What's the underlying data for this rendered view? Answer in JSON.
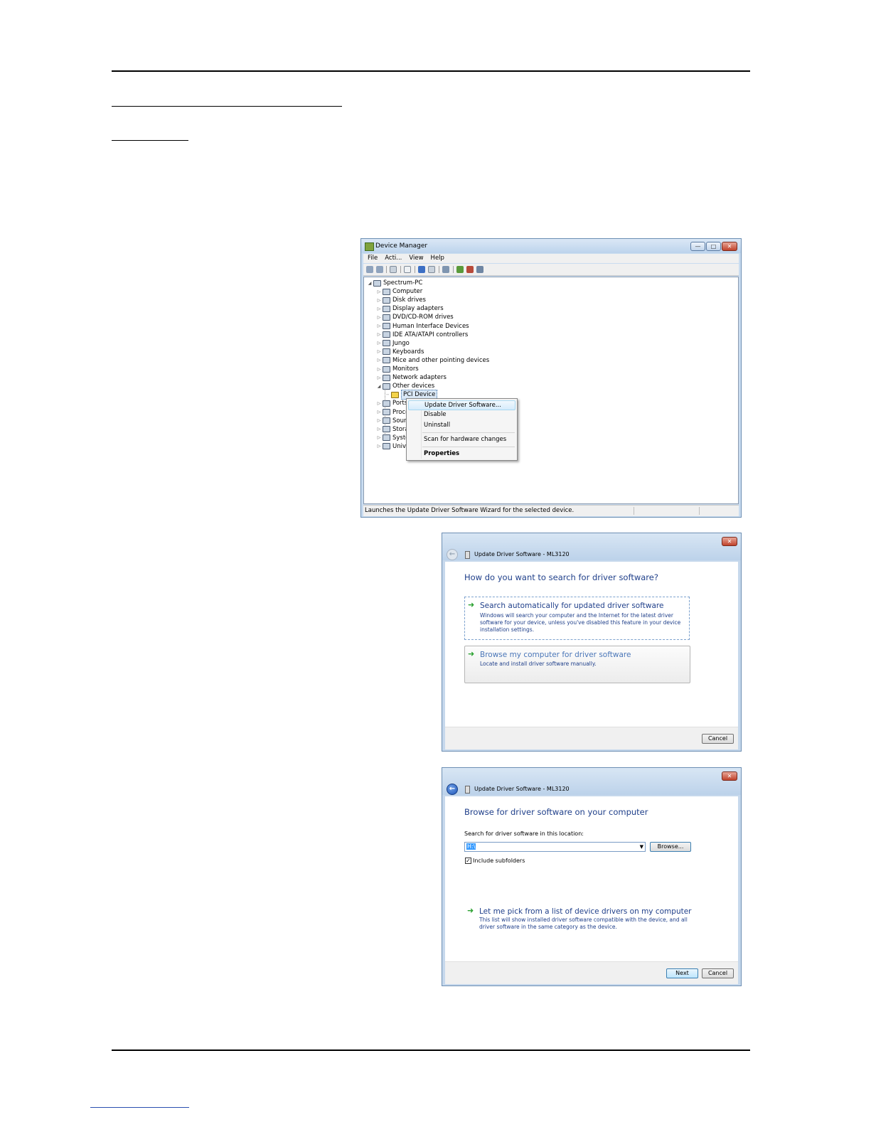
{
  "device_manager": {
    "title": "Device Manager",
    "menu": [
      "File",
      "Acti...",
      "View",
      "Help"
    ],
    "tree": [
      {
        "label": "Spectrum-PC",
        "icon": "computer-network-icon",
        "level": 0,
        "expander": "open"
      },
      {
        "label": "Computer",
        "icon": "computer-icon",
        "level": 1,
        "expander": "closed"
      },
      {
        "label": "Disk drives",
        "icon": "disk-drive-icon",
        "level": 1,
        "expander": "closed"
      },
      {
        "label": "Display adapters",
        "icon": "display-adapter-icon",
        "level": 1,
        "expander": "closed"
      },
      {
        "label": "DVD/CD-ROM drives",
        "icon": "dvd-drive-icon",
        "level": 1,
        "expander": "closed"
      },
      {
        "label": "Human Interface Devices",
        "icon": "hid-icon",
        "level": 1,
        "expander": "closed"
      },
      {
        "label": "IDE ATA/ATAPI controllers",
        "icon": "ide-controller-icon",
        "level": 1,
        "expander": "closed"
      },
      {
        "label": "Jungo",
        "icon": "jungo-icon",
        "level": 1,
        "expander": "closed"
      },
      {
        "label": "Keyboards",
        "icon": "keyboard-icon",
        "level": 1,
        "expander": "closed"
      },
      {
        "label": "Mice and other pointing devices",
        "icon": "mouse-icon",
        "level": 1,
        "expander": "closed"
      },
      {
        "label": "Monitors",
        "icon": "monitor-icon",
        "level": 1,
        "expander": "closed"
      },
      {
        "label": "Network adapters",
        "icon": "network-adapter-icon",
        "level": 1,
        "expander": "closed"
      },
      {
        "label": "Other devices",
        "icon": "other-devices-icon",
        "level": 1,
        "expander": "open"
      },
      {
        "label": "PCI Device",
        "icon": "warning-device-icon",
        "level": 2,
        "expander": "none",
        "selected": true
      },
      {
        "label": "Ports",
        "icon": "port-icon",
        "level": 1,
        "expander": "closed"
      },
      {
        "label": "Proce",
        "icon": "processor-icon",
        "level": 1,
        "expander": "closed"
      },
      {
        "label": "Soun",
        "icon": "sound-icon",
        "level": 1,
        "expander": "closed"
      },
      {
        "label": "Stora",
        "icon": "storage-icon",
        "level": 1,
        "expander": "closed"
      },
      {
        "label": "Syste",
        "icon": "system-icon",
        "level": 1,
        "expander": "closed"
      },
      {
        "label": "Unive",
        "icon": "usb-icon",
        "level": 1,
        "expander": "closed"
      }
    ],
    "context_menu": [
      {
        "label": "Update Driver Software...",
        "highlighted": true
      },
      {
        "label": "Disable"
      },
      {
        "label": "Uninstall"
      },
      {
        "label": "Scan for hardware changes"
      },
      {
        "label": "Properties",
        "bold": true
      }
    ],
    "status": "Launches the Update Driver Software Wizard for the selected device."
  },
  "wizard1": {
    "title": "Update Driver Software - ML3120",
    "heading": "How do you want to search for driver software?",
    "option1_title": "Search automatically for updated driver software",
    "option1_desc": "Windows will search your computer and the Internet for the latest driver software for your device, unless you've disabled this feature in your device installation settings.",
    "option2_title": "Browse my computer for driver software",
    "option2_desc": "Locate and install driver software manually.",
    "cancel": "Cancel"
  },
  "wizard2": {
    "title": "Update Driver Software - ML3120",
    "heading": "Browse for driver software on your computer",
    "search_label": "Search for driver software in this location:",
    "path_value": "H:\\",
    "browse": "Browse...",
    "include_subfolders": "Include subfolders",
    "include_subfolders_checked": true,
    "pick_title": "Let me pick from a list of device drivers on my computer",
    "pick_desc": "This list will show installed driver software compatible with the device, and all driver software in the same category as the device.",
    "next": "Next",
    "cancel": "Cancel"
  },
  "colors": {
    "heading_blue": "#1f3f8a",
    "green_arrow": "#2aa130",
    "frame_blue": "#c6d8ec",
    "selection": "#3399ff"
  }
}
